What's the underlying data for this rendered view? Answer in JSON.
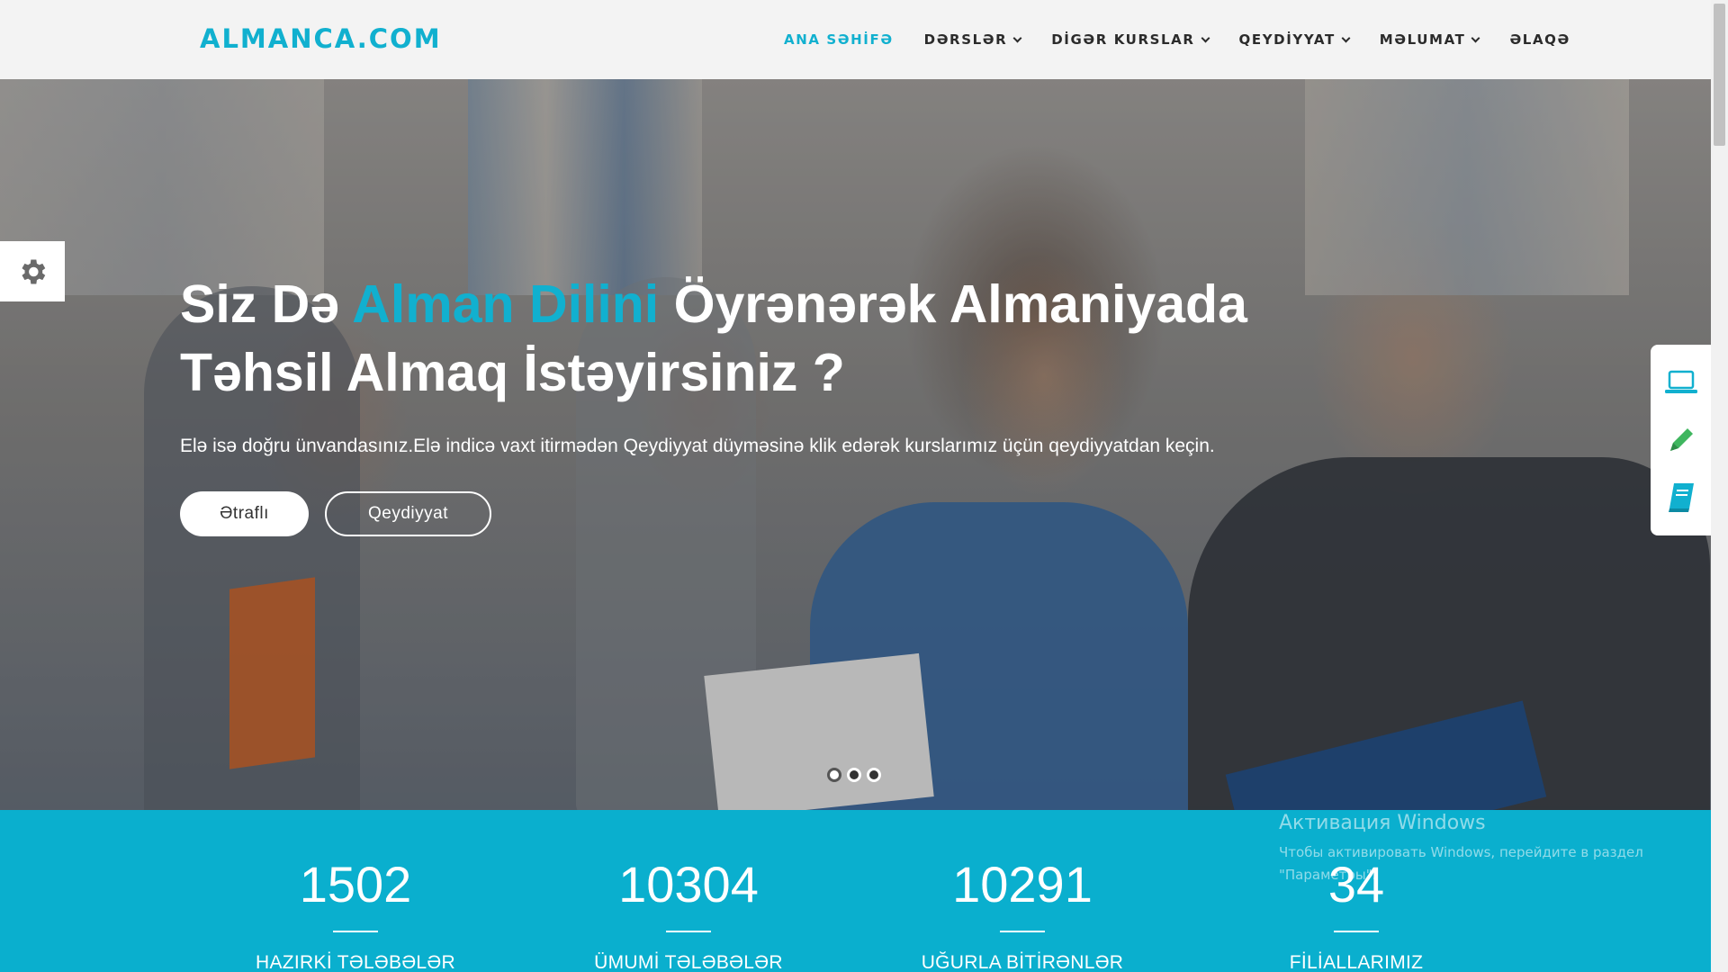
{
  "brand": {
    "logo": "ALMANCA.COM",
    "accent_color": "#11b0cf"
  },
  "nav": {
    "items": [
      {
        "label": "ANA SƏHİFƏ",
        "active": true,
        "dropdown": false
      },
      {
        "label": "DƏRSLƏR",
        "active": false,
        "dropdown": true
      },
      {
        "label": "DİGƏR KURSLAR",
        "active": false,
        "dropdown": true
      },
      {
        "label": "QEYDİYYAT",
        "active": false,
        "dropdown": true
      },
      {
        "label": "MƏLUMAT",
        "active": false,
        "dropdown": true
      },
      {
        "label": "ƏLAQƏ",
        "active": false,
        "dropdown": false
      }
    ]
  },
  "hero": {
    "title_part1": "Siz Də ",
    "title_accent": "Alman Dilini",
    "title_part2": " Öyrənərək Almaniyada Təhsil Almaq İstəyirsiniz ?",
    "subtitle": "Elə isə doğru ünvandasınız.Elə indicə vaxt itirmədən Qeydiyyat düyməsinə klik edərək kurslarımız üçün qeydiyyatdan keçin.",
    "button_primary": "Ətraflı",
    "button_secondary": "Qeydiyyat",
    "slides": {
      "count": 3,
      "active_index": 0
    }
  },
  "side_panel": {
    "icons": [
      "laptop-icon",
      "pencil-icon",
      "book-icon"
    ]
  },
  "settings": {
    "icon": "gear-icon"
  },
  "stats": [
    {
      "value": "1502",
      "label": "HAZIRKİ TƏLƏBƏLƏR"
    },
    {
      "value": "10304",
      "label": "ÜMUMİ TƏLƏBƏLƏR"
    },
    {
      "value": "10291",
      "label": "UĞURLA BİTİRƏNLƏR"
    },
    {
      "value": "34",
      "label": "FİLİALLARIMIZ"
    }
  ],
  "watermark": {
    "title": "Активация Windows",
    "text": "Чтобы активировать Windows, перейдите в раздел \"Параметры\"."
  },
  "colors": {
    "stats_bg": "#0aafce",
    "header_bg": "#f3f3f3"
  }
}
